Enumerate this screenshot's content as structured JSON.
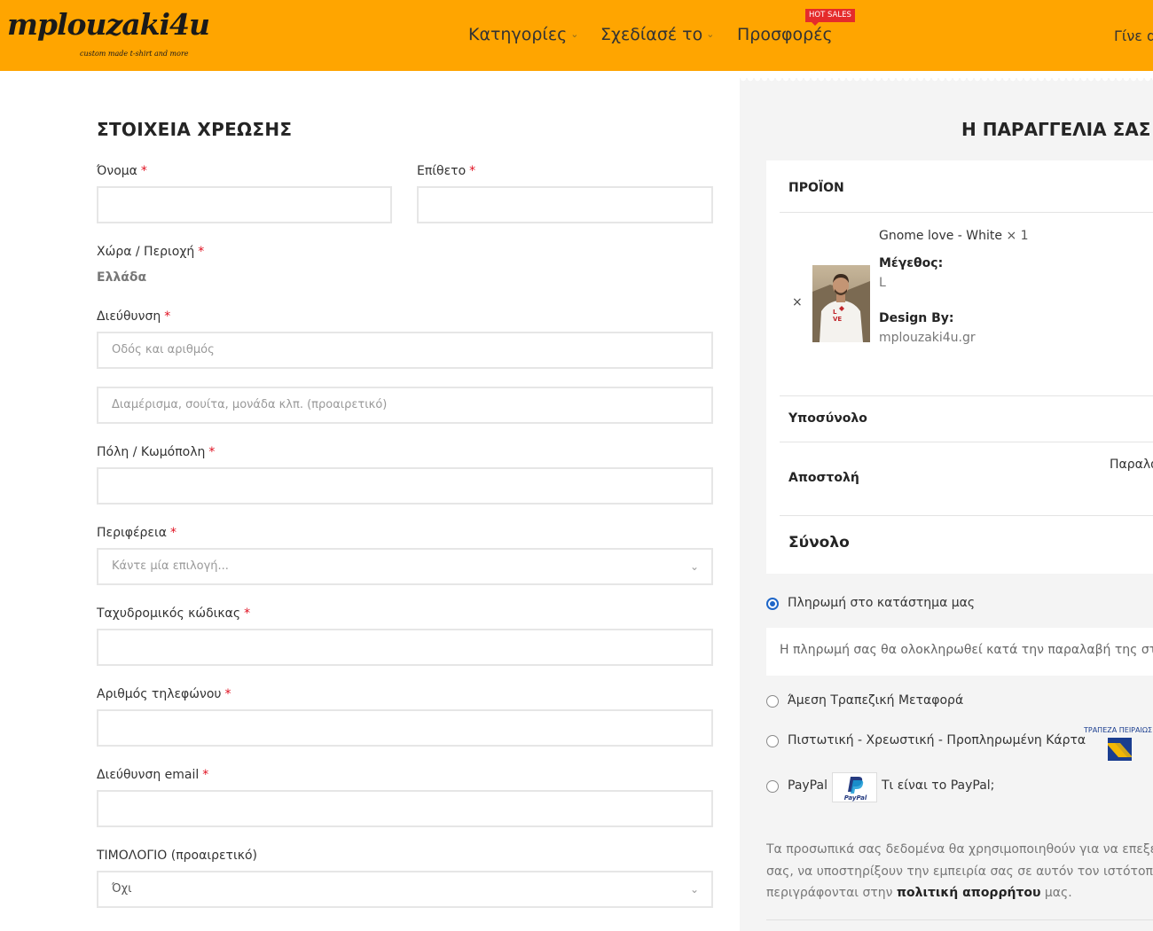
{
  "header": {
    "logo_text": "mplouzaki4u",
    "logo_tagline": "custom made t-shirt and more",
    "nav": [
      {
        "label": "Κατηγορίες",
        "has_dropdown": true
      },
      {
        "label": "Σχεδίασέ το",
        "has_dropdown": true
      },
      {
        "label": "Προσφορές",
        "has_dropdown": false
      },
      {
        "label": "Γίνε d",
        "has_dropdown": false
      }
    ],
    "hot_badge": "HOT SALES",
    "colors": {
      "bar": "#ffa500",
      "badge": "#e52b2b"
    }
  },
  "billing": {
    "title": "ΣΤΟΙΧΕΙΑ ΧΡΕΩΣΗΣ",
    "required_mark": "*",
    "first_name": {
      "label": "Όνομα",
      "value": ""
    },
    "last_name": {
      "label": "Επίθετο",
      "value": ""
    },
    "country": {
      "label": "Χώρα / Περιοχή",
      "value": "Ελλάδα"
    },
    "address": {
      "label": "Διεύθυνση",
      "placeholder1": "Οδός και αριθμός",
      "placeholder2": "Διαμέρισμα, σουίτα, μονάδα κλπ. (προαιρετικό)"
    },
    "city": {
      "label": "Πόλη / Κωμόπολη",
      "value": ""
    },
    "region": {
      "label": "Περιφέρεια",
      "placeholder": "Κάντε μία επιλογή..."
    },
    "postcode": {
      "label": "Ταχυδρομικός κώδικας",
      "value": ""
    },
    "phone": {
      "label": "Αριθμός τηλεφώνου",
      "value": ""
    },
    "email": {
      "label": "Διεύθυνση email",
      "value": ""
    },
    "invoice": {
      "label": "ΤΙΜΟΛΟΓΙΟ (προαιρετικό)",
      "value": "Όχι"
    }
  },
  "order": {
    "title": "Η ΠΑΡΑΓΓΕΛΙΑ ΣΑΣ",
    "product_header": "ΠΡΟΪΟΝ",
    "remove_symbol": "×",
    "item": {
      "name": "Gnome love - White",
      "qty": "× 1",
      "size_label": "Μέγεθος:",
      "size_value": "L",
      "design_label": "Design By:",
      "design_value": "mplouzaki4u.gr",
      "shirt_print": "VE"
    },
    "subtotal_label": "Υποσύνολο",
    "shipping_label": "Αποστολή",
    "shipping_option": "Παραλα",
    "total_label": "Σύνολο"
  },
  "payment": {
    "methods": [
      {
        "label": "Πληρωμή στο κατάστημα μας",
        "selected": true
      },
      {
        "label": "Άμεση Τραπεζική Μεταφορά",
        "selected": false
      },
      {
        "label": "Πιστωτική - Χρεωστική - Προπληρωμένη Κάρτα",
        "selected": false
      },
      {
        "label": "PayPal",
        "selected": false
      }
    ],
    "store_description": "Η πληρωμή σας θα ολοκληρωθεί κατά την παραλαβή της στο",
    "bank_name": "ΤΡΑΠΕΖΑ ΠΕΙΡΑΙΩΣ",
    "paypal_logo_text": "PayPal",
    "paypal_link": "Τι είναι το PayPal;",
    "accent_color": "#1e66c8"
  },
  "privacy": {
    "line1": "Τα προσωπικά σας δεδομένα θα χρησιμοποιηθούν για να επεξερ",
    "line2": "σας, να υποστηρίξουν την εμπειρία σας σε αυτόν τον ιστότοπο κ",
    "line3_pre": "περιγράφονται στην ",
    "line3_link": "πολιτική απορρήτου",
    "line3_post": " μας."
  }
}
